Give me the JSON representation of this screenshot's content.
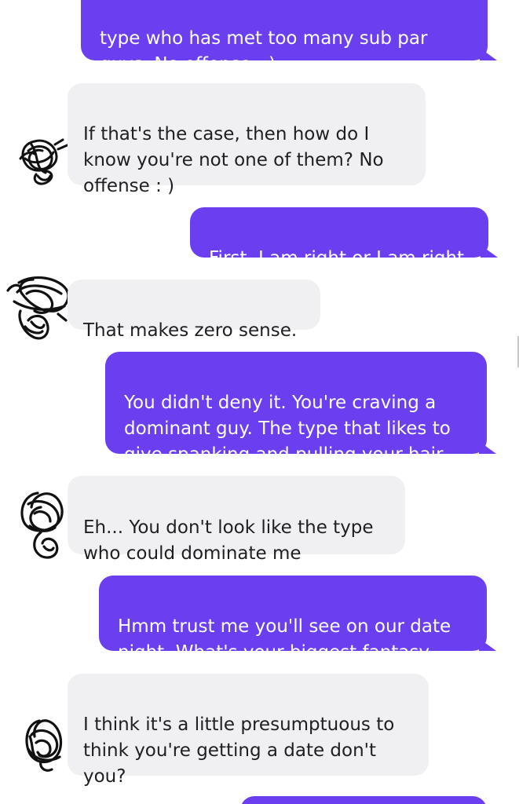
{
  "conversation": {
    "messages": [
      {
        "from": "me",
        "text": "type who has met too many sub par\nguys. No offense : )"
      },
      {
        "from": "match",
        "text": "If that's the case, then how do I\nknow you're not one of them? No\noffense : )"
      },
      {
        "from": "me",
        "text": "First, I am right or I am right"
      },
      {
        "from": "match",
        "text": "That makes zero sense."
      },
      {
        "from": "me",
        "text": "You didn't deny it. You're craving a\ndominant guy. The type that likes to\ngive spanking and pulling your hair"
      },
      {
        "from": "match",
        "text": "Eh... You don't look like the type\nwho could dominate me"
      },
      {
        "from": "me",
        "text": "Hmm trust me you'll see on our date\nnight. What's your biggest fantasy"
      },
      {
        "from": "match",
        "text": "I think it's a little presumptuous to\nthink you're getting a date don't\nyou?"
      },
      {
        "from": "me",
        "text": ""
      }
    ]
  },
  "theme": {
    "outgoing_color": "#6b3ff0",
    "incoming_color": "#f0f0f2",
    "avatar_state": "scribbled-out"
  }
}
